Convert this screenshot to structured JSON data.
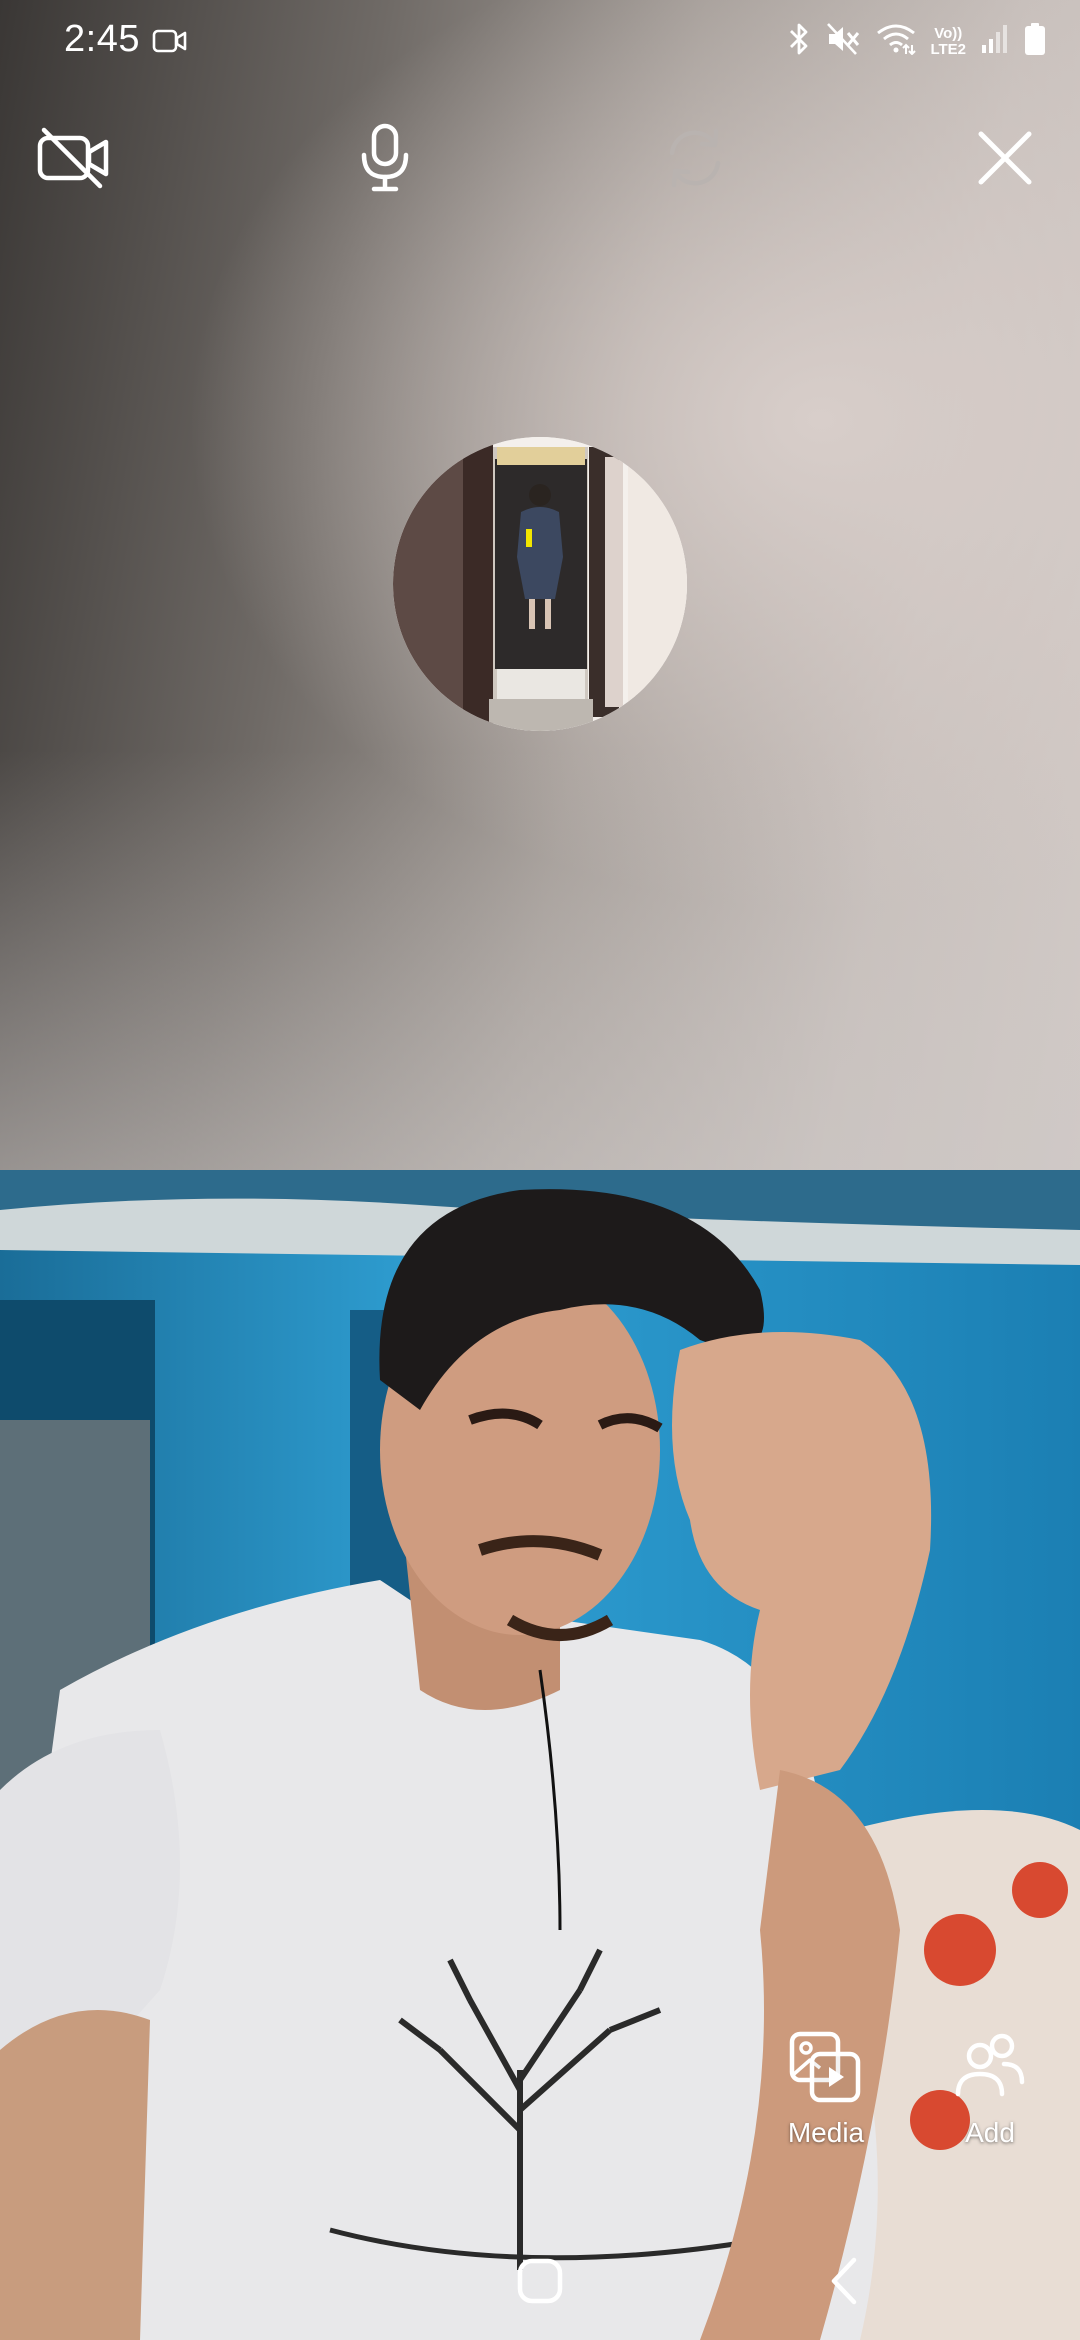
{
  "status_bar": {
    "time": "2:45",
    "icons": [
      "video-recording-icon",
      "bluetooth-icon",
      "mute-icon",
      "wifi-icon",
      "volte-icon",
      "signal-icon",
      "battery-icon"
    ],
    "network_label": "Vo))\nLTE2"
  },
  "controls": {
    "buttons": [
      {
        "name": "video-off",
        "icon": "video-off-icon"
      },
      {
        "name": "microphone",
        "icon": "microphone-icon"
      },
      {
        "name": "flip-camera",
        "icon": "flip-camera-icon",
        "disabled": true
      },
      {
        "name": "end-call",
        "icon": "close-icon"
      }
    ]
  },
  "actions": {
    "media_label": "Media",
    "add_label": "Add"
  },
  "colors": {
    "icon": "#ffffff",
    "disabled_icon": "#b9b3b0",
    "wall_blue": "#1e86b9",
    "shirt": "#e8e8ea"
  }
}
